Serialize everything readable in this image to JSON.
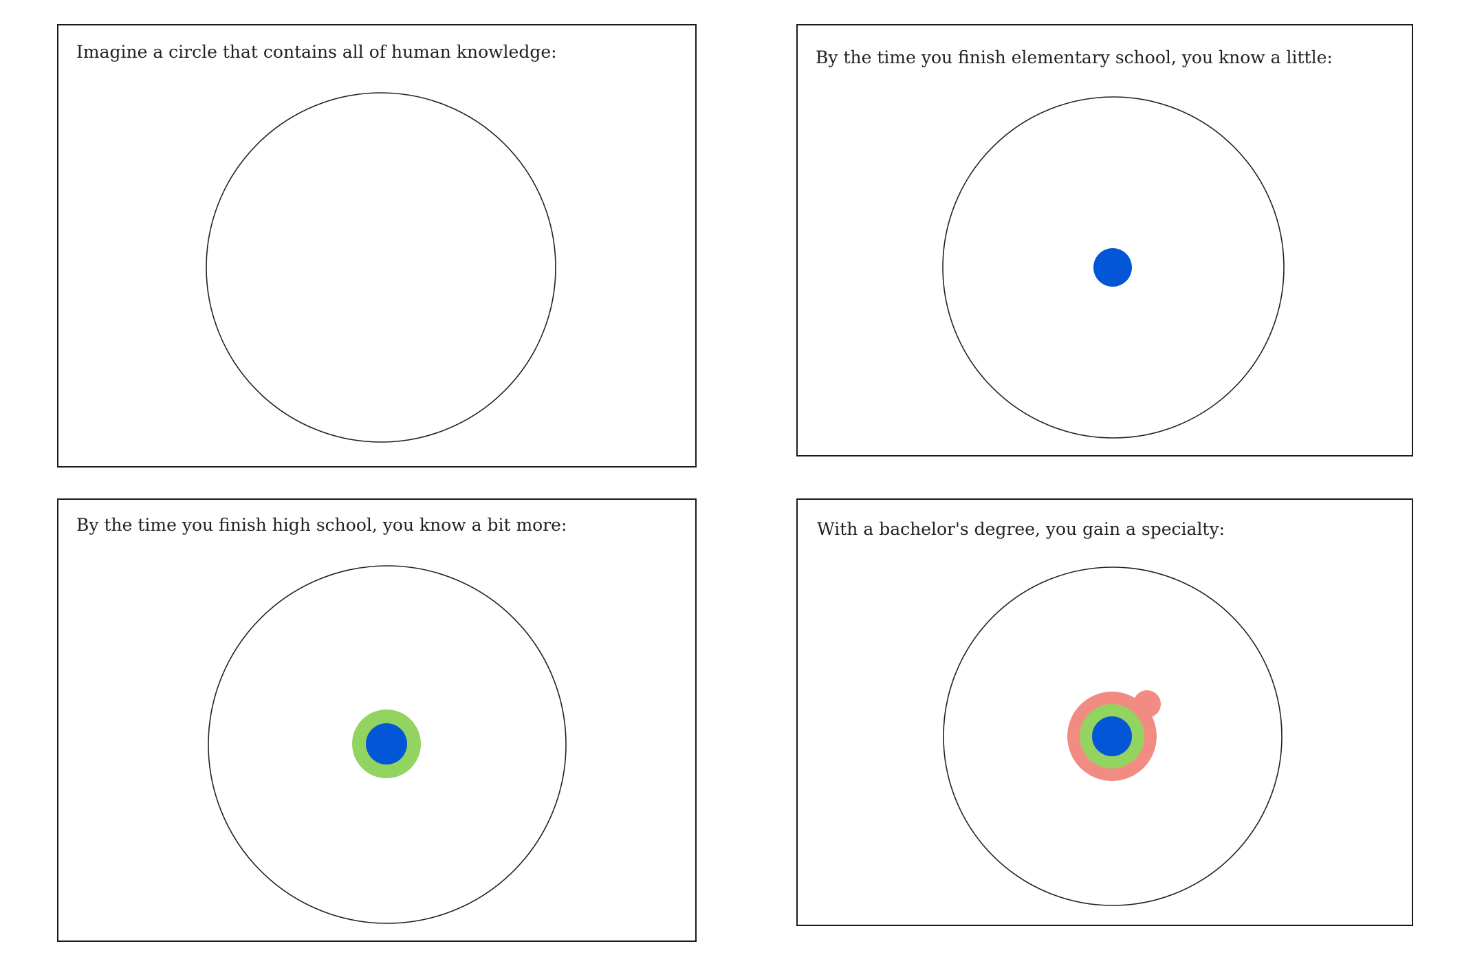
{
  "colors": {
    "elementary": "#0356d6",
    "high_school": "#93d35f",
    "bachelors": "#f28b82",
    "knowledge_outline": "#222222",
    "frame": "#1a1a1a"
  },
  "panels": [
    {
      "caption": "Imagine a circle that contains all of human knowledge:",
      "layers": []
    },
    {
      "caption": "By the time you finish elementary school, you know a little:",
      "layers": [
        "elementary"
      ]
    },
    {
      "caption": "By the time you finish high school, you know a bit more:",
      "layers": [
        "high_school",
        "elementary"
      ]
    },
    {
      "caption": "With a bachelor's degree, you gain a specialty:",
      "layers": [
        "bachelors",
        "high_school",
        "elementary"
      ]
    }
  ]
}
